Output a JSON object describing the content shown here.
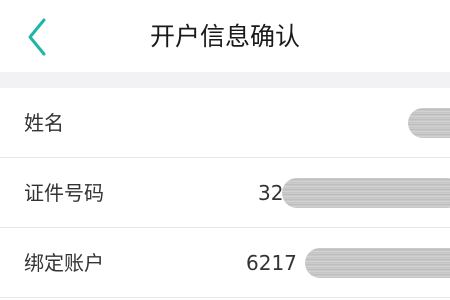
{
  "header": {
    "title": "开户信息确认",
    "back_icon": "chevron-left-icon",
    "accent_color": "#1fb5a8"
  },
  "rows": [
    {
      "label": "姓名",
      "value_prefix": ""
    },
    {
      "label": "证件号码",
      "value_prefix": "32"
    },
    {
      "label": "绑定账户",
      "value_prefix": "6217"
    }
  ]
}
